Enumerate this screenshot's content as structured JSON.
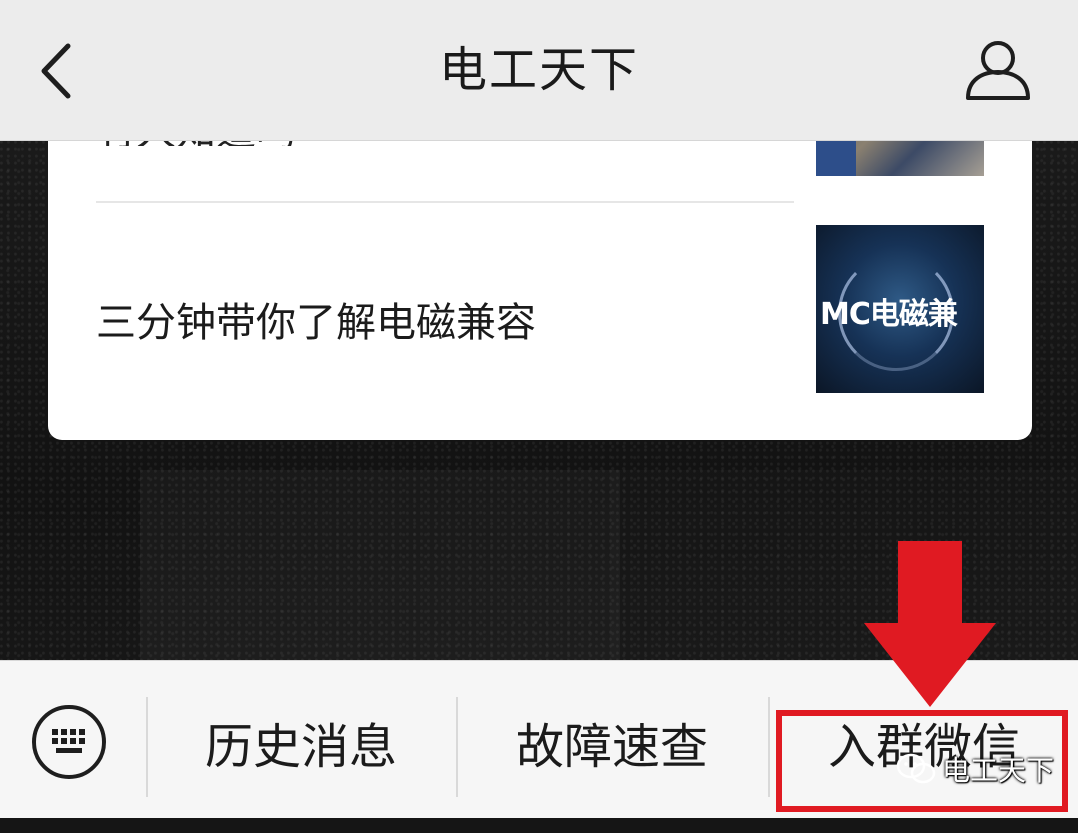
{
  "header": {
    "title": "电工天下",
    "back_icon": "chevron-left-icon",
    "profile_icon": "person-icon"
  },
  "articles": [
    {
      "title_partial": "有人知道吗",
      "thumbnail": "industrial-photo"
    },
    {
      "title": "三分钟带你了解电磁兼容",
      "thumbnail_text": "MC电磁兼"
    }
  ],
  "menu": {
    "keyboard_icon": "keyboard-icon",
    "items": [
      {
        "label": "历史消息"
      },
      {
        "label": "故障速查"
      },
      {
        "label": "入群微信"
      }
    ]
  },
  "annotation": {
    "arrow_color": "#e01a22",
    "box_color": "#e01a22"
  },
  "watermark": {
    "text": "电工天下"
  },
  "colors": {
    "header_bg": "#ececec",
    "menu_bg": "#f6f6f6",
    "card_bg": "#ffffff"
  }
}
